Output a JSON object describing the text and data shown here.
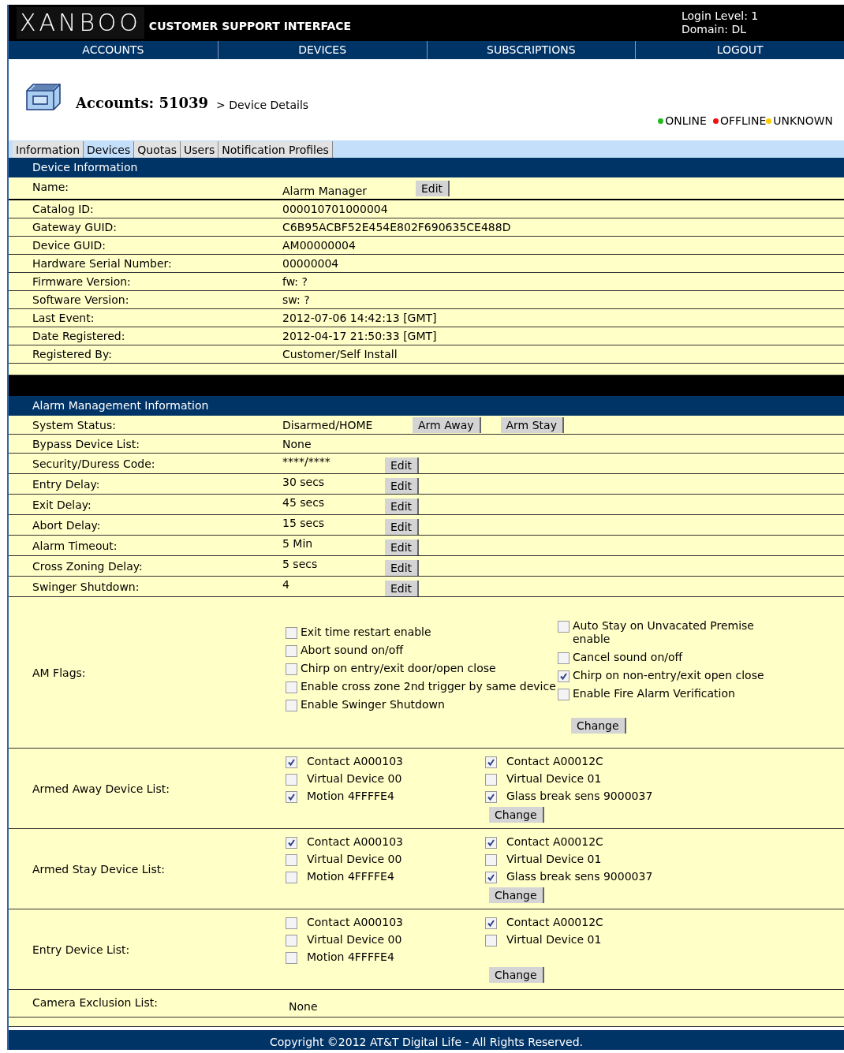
{
  "header": {
    "logo": "XANBOO",
    "title": "CUSTOMER SUPPORT INTERFACE",
    "login_level": "Login Level: 1",
    "domain": "Domain: DL"
  },
  "nav": [
    {
      "label": "ACCOUNTS"
    },
    {
      "label": "DEVICES"
    },
    {
      "label": "SUBSCRIPTIONS"
    },
    {
      "label": "LOGOUT"
    }
  ],
  "breadcrumb": {
    "account": "Accounts: 51039",
    "trail": "> Device Details"
  },
  "legend": [
    {
      "label": "ONLINE",
      "color": "#22bb22"
    },
    {
      "label": "OFFLINE",
      "color": "#ee1111"
    },
    {
      "label": "UNKNOWN",
      "color": "#ffcc00"
    }
  ],
  "tabs": [
    {
      "label": "Information",
      "selected": false
    },
    {
      "label": "Devices",
      "selected": true
    },
    {
      "label": "Quotas",
      "selected": false
    },
    {
      "label": "Users",
      "selected": false
    },
    {
      "label": "Notification Profiles",
      "selected": false
    }
  ],
  "device_information": {
    "title": "Device Information",
    "rows": [
      {
        "label": "Name:",
        "value": "Alarm Manager",
        "buttons": [
          "Edit"
        ]
      },
      {
        "label": "Catalog ID:",
        "value": "000010701000004"
      },
      {
        "label": "Gateway GUID:",
        "value": "C6B95ACBF52E454E802F690635CE488D"
      },
      {
        "label": "Device GUID:",
        "value": "AM00000004"
      },
      {
        "label": "Hardware Serial Number:",
        "value": "00000004"
      },
      {
        "label": "Firmware Version:",
        "value": "fw: ?"
      },
      {
        "label": "Software Version:",
        "value": "sw: ?"
      },
      {
        "label": "Last Event:",
        "value": "2012-07-06 14:42:13 [GMT]"
      },
      {
        "label": "Date Registered:",
        "value": "2012-04-17 21:50:33 [GMT]"
      },
      {
        "label": "Registered By:",
        "value": "Customer/Self Install"
      }
    ]
  },
  "alarm_management": {
    "title": "Alarm Management Information",
    "rows": [
      {
        "label": "System Status:",
        "value": "Disarmed/HOME",
        "buttons": [
          "Arm Away",
          "Arm Stay"
        ]
      },
      {
        "label": "Bypass Device List:",
        "value": "None"
      },
      {
        "label": "Security/Duress Code:",
        "value": "****/****",
        "buttons": [
          "Edit"
        ]
      },
      {
        "label": "Entry Delay:",
        "value": "30 secs",
        "buttons": [
          "Edit"
        ]
      },
      {
        "label": "Exit Delay:",
        "value": "45 secs",
        "buttons": [
          "Edit"
        ]
      },
      {
        "label": "Abort Delay:",
        "value": "15 secs",
        "buttons": [
          "Edit"
        ]
      },
      {
        "label": "Alarm Timeout:",
        "value": "5 Min",
        "buttons": [
          "Edit"
        ]
      },
      {
        "label": "Cross Zoning Delay:",
        "value": "5 secs",
        "buttons": [
          "Edit"
        ]
      },
      {
        "label": "Swinger Shutdown:",
        "value": "4",
        "buttons": [
          "Edit"
        ]
      }
    ]
  },
  "am_flags": {
    "label": "AM Flags:",
    "left": [
      {
        "label": "Exit time restart enable",
        "checked": false
      },
      {
        "label": "Abort sound on/off",
        "checked": false
      },
      {
        "label": "Chirp on entry/exit door/open close",
        "checked": false
      },
      {
        "label": "Enable cross zone 2nd trigger by same device",
        "checked": false
      },
      {
        "label": "Enable Swinger Shutdown",
        "checked": false
      }
    ],
    "right": [
      {
        "label": "Auto Stay on Unvacated Premise enable",
        "checked": false
      },
      {
        "label": "Cancel sound on/off",
        "checked": false
      },
      {
        "label": "Chirp on non-entry/exit open close",
        "checked": true
      },
      {
        "label": "Enable Fire Alarm Verification",
        "checked": false
      }
    ],
    "button": "Change"
  },
  "device_lists": [
    {
      "label": "Armed Away Device List:",
      "left": [
        {
          "label": "Contact A000103",
          "checked": true
        },
        {
          "label": "Virtual Device 00",
          "checked": false
        },
        {
          "label": "Motion 4FFFFE4",
          "checked": true
        }
      ],
      "right": [
        {
          "label": "Contact A00012C",
          "checked": true
        },
        {
          "label": "Virtual Device 01",
          "checked": false
        },
        {
          "label": "Glass break sens 9000037",
          "checked": true
        }
      ],
      "button": "Change"
    },
    {
      "label": "Armed Stay Device List:",
      "left": [
        {
          "label": "Contact A000103",
          "checked": true
        },
        {
          "label": "Virtual Device 00",
          "checked": false
        },
        {
          "label": "Motion 4FFFFE4",
          "checked": false
        }
      ],
      "right": [
        {
          "label": "Contact A00012C",
          "checked": true
        },
        {
          "label": "Virtual Device 01",
          "checked": false
        },
        {
          "label": "Glass break sens 9000037",
          "checked": true
        }
      ],
      "button": "Change"
    },
    {
      "label": "Entry Device List:",
      "left": [
        {
          "label": "Contact A000103",
          "checked": false
        },
        {
          "label": "Virtual Device 00",
          "checked": false
        },
        {
          "label": "Motion 4FFFFE4",
          "checked": false
        }
      ],
      "right": [
        {
          "label": "Contact A00012C",
          "checked": true
        },
        {
          "label": "Virtual Device 01",
          "checked": false
        }
      ],
      "button": "Change"
    }
  ],
  "camera_exclusion": {
    "label": "Camera Exclusion List:",
    "value": "None"
  },
  "footer": "Copyright ©2012 AT&T Digital Life - All Rights Reserved."
}
